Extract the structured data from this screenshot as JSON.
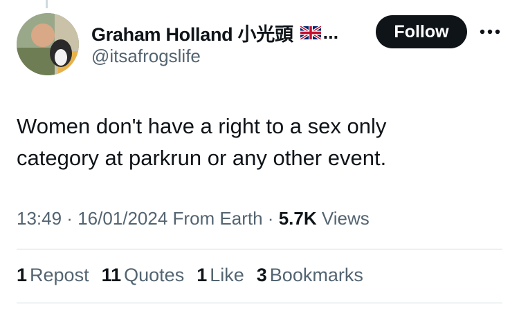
{
  "author": {
    "display_name": "Graham Holland 小光頭",
    "flag_icon": "uk-flag-icon",
    "truncation": "...",
    "handle": "@itsafrogslife"
  },
  "follow_label": "Follow",
  "more_icon": "more-horizontal-icon",
  "tweet_text": "Women don't have a right to a sex only\ncategory at parkrun or any other event.",
  "meta": {
    "time": "13:49",
    "sep1": " · ",
    "date": "16/01/2024",
    "source": " From Earth",
    "sep2": " · ",
    "views_count": "5.7K",
    "views_label": " Views"
  },
  "stats": [
    {
      "count": "1",
      "label": "Repost"
    },
    {
      "count": "11",
      "label": "Quotes"
    },
    {
      "count": "1",
      "label": "Like"
    },
    {
      "count": "3",
      "label": "Bookmarks"
    }
  ],
  "colors": {
    "text_primary": "#0f1419",
    "text_secondary": "#536471",
    "button_bg": "#0f1419",
    "divider": "#cfd9de"
  }
}
